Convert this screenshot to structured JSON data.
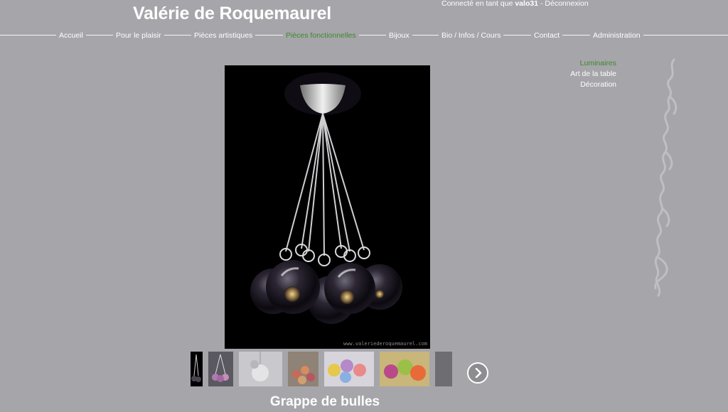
{
  "site": {
    "title": "Valérie de Roquemaurel"
  },
  "user": {
    "prefix": "Connecté en tant que",
    "name": "valo31",
    "separator": " - ",
    "logout": "Déconnexion"
  },
  "nav": {
    "items": [
      {
        "label": "Accueil"
      },
      {
        "label": "Pour le plaisir"
      },
      {
        "label": "Pièces artistiques"
      },
      {
        "label": "Pièces fonctionnelles",
        "active": true
      },
      {
        "label": "Bijoux"
      },
      {
        "label": "Bio / Infos / Cours"
      },
      {
        "label": "Contact"
      },
      {
        "label": "Administration"
      }
    ]
  },
  "subnav": {
    "items": [
      {
        "label": "Luminaires",
        "active": true
      },
      {
        "label": "Art de la table"
      },
      {
        "label": "Décoration"
      }
    ]
  },
  "photo": {
    "watermark": "www.valeriederoquemaurel.com",
    "caption": "Grappe de bulles"
  },
  "colors": {
    "background": "#a6a5aa",
    "active": "#3c8a2c",
    "text": "#ffffff"
  },
  "icons": {
    "next": "chevron-right-icon"
  }
}
